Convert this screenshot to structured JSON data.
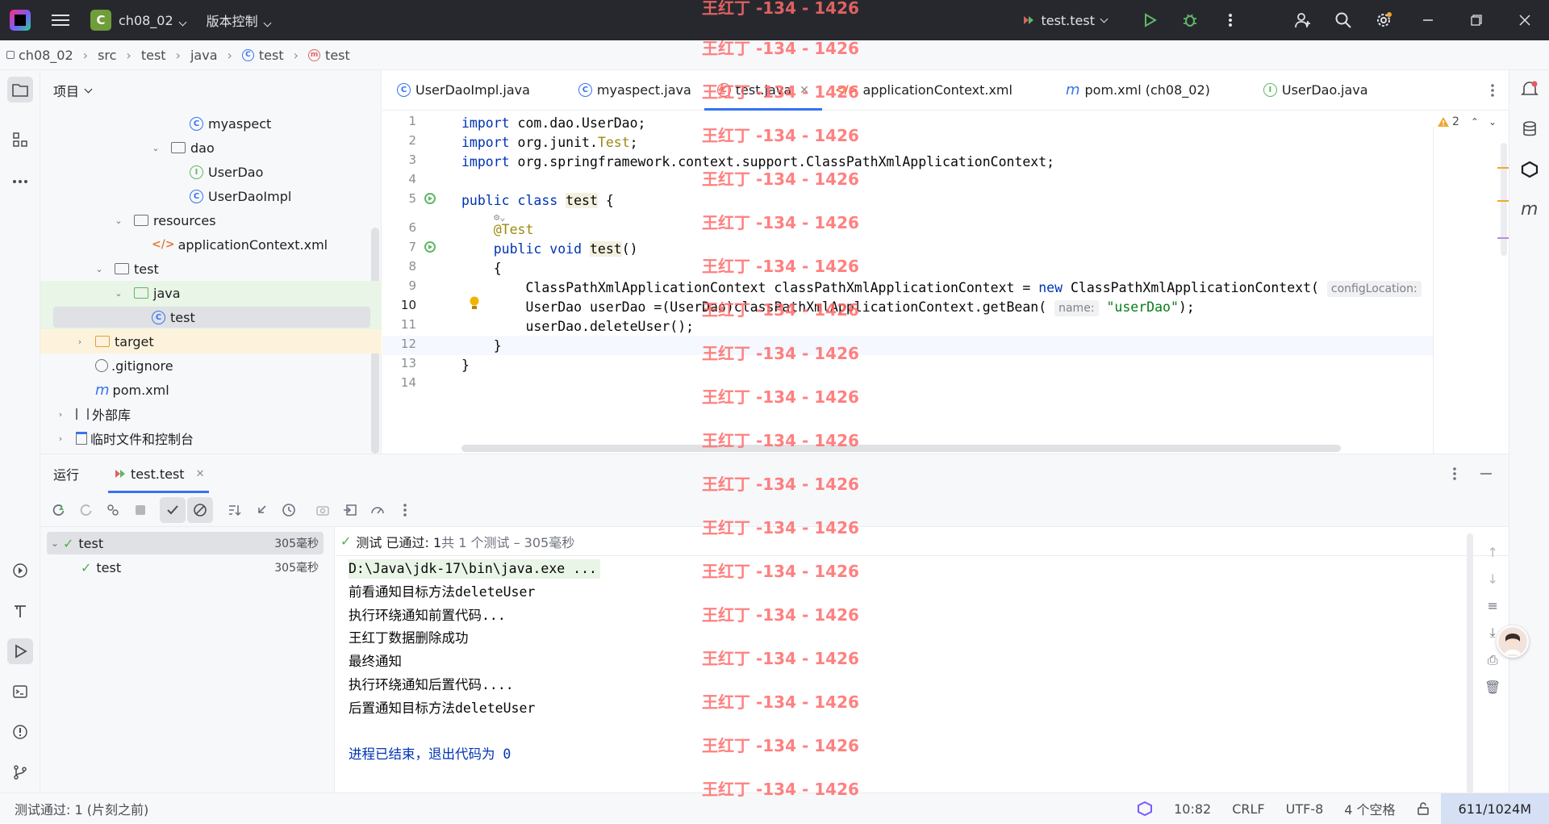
{
  "titlebar": {
    "project_badge": "C",
    "project_name": "ch08_02",
    "vcs_label": "版本控制",
    "run_config": "test.test"
  },
  "breadcrumb": [
    "ch08_02",
    "src",
    "test",
    "java",
    "test",
    "test"
  ],
  "project_panel": {
    "title": "项目",
    "tree": [
      {
        "label": "myaspect",
        "icon": "class-icon"
      },
      {
        "label": "dao",
        "icon": "package-icon"
      },
      {
        "label": "UserDao",
        "icon": "interface-icon"
      },
      {
        "label": "UserDaoImpl",
        "icon": "class-icon"
      },
      {
        "label": "resources",
        "icon": "resources-folder-icon"
      },
      {
        "label": "applicationContext.xml",
        "icon": "xml-file-icon"
      },
      {
        "label": "test",
        "icon": "folder-icon"
      },
      {
        "label": "java",
        "icon": "test-source-folder-icon"
      },
      {
        "label": "test",
        "icon": "class-icon"
      },
      {
        "label": "target",
        "icon": "excluded-folder-icon"
      },
      {
        "label": ".gitignore",
        "icon": "ignore-file-icon"
      },
      {
        "label": "pom.xml",
        "icon": "maven-icon"
      },
      {
        "label": "外部库",
        "icon": "library-icon"
      },
      {
        "label": "临时文件和控制台",
        "icon": "scratch-icon"
      }
    ]
  },
  "tabs": [
    {
      "label": "UserDaoImpl.java",
      "icon": "class-icon"
    },
    {
      "label": "myaspect.java",
      "icon": "class-icon"
    },
    {
      "label": "test.java",
      "icon": "test-class-icon",
      "active": true
    },
    {
      "label": "applicationContext.xml",
      "icon": "xml-file-icon"
    },
    {
      "label": "pom.xml (ch08_02)",
      "icon": "maven-icon"
    },
    {
      "label": "UserDao.java",
      "icon": "interface-icon"
    }
  ],
  "editor": {
    "warning_count": "2",
    "line_numbers": [
      "1",
      "2",
      "3",
      "4",
      "5",
      "6",
      "7",
      "8",
      "9",
      "10",
      "11",
      "12",
      "13",
      "14"
    ],
    "hint_config": "configLocation:",
    "hint_name": "name:"
  },
  "watermark": "王红丁 -134 - 1426",
  "run_panel": {
    "title": "运行",
    "tab_label": "test.test",
    "status_prefix": "测试 已通过: 1",
    "status_suffix": "共 1 个测试 – 305毫秒",
    "tests": [
      {
        "name": "test",
        "duration": "305毫秒"
      },
      {
        "name": "test",
        "duration": "305毫秒"
      }
    ],
    "console_lines": [
      "D:\\Java\\jdk-17\\bin\\java.exe ...",
      "前看通知目标方法deleteUser",
      "执行环绕通知前置代码...",
      "王红丁数据删除成功",
      "最终通知",
      "执行环绕通知后置代码....",
      "后置通知目标方法deleteUser",
      "",
      "进程已结束，退出代码为 0"
    ]
  },
  "statusbar": {
    "message": "测试通过: 1 (片刻之前)",
    "position": "10:82",
    "line_sep": "CRLF",
    "encoding": "UTF-8",
    "indent": "4 个空格",
    "memory": "611/1024M"
  },
  "colors": {
    "accent": "#3574f0",
    "success": "#4caf50",
    "watermark": "#ff6b6b",
    "titlebar_bg": "#27282e"
  }
}
